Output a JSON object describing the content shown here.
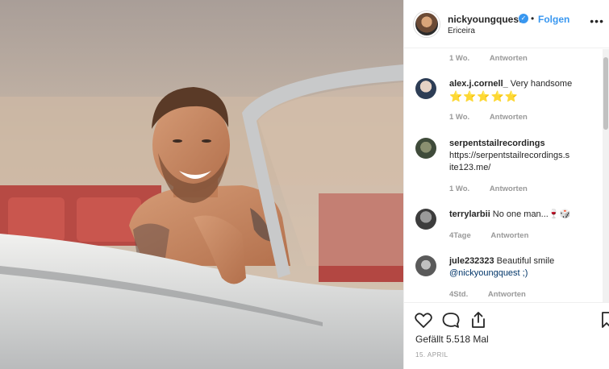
{
  "post": {
    "username": "nickyoungquest",
    "verified_mark": "✓",
    "separator": "•",
    "follow_label": "Folgen",
    "location": "Ericeira",
    "more_icon": "•••"
  },
  "first_meta": {
    "time": "1 Wo.",
    "reply": "Antworten"
  },
  "comments": [
    {
      "user": "alex.j.cornell_",
      "text": "Very handsome",
      "extra": "⭐⭐⭐⭐⭐",
      "time": "1 Wo.",
      "reply": "Antworten"
    },
    {
      "user": "serpentstailrecordings",
      "text": "https://serpentstailrecordings.site123.me/",
      "time": "1 Wo.",
      "reply": "Antworten"
    },
    {
      "user": "terrylarbii",
      "text": "No one man...🍷🎲",
      "time": "4Tage",
      "reply": "Antworten"
    },
    {
      "user": "jule232323",
      "text": "Beautiful smile",
      "mention": "@nickyoungquest ;)",
      "time": "4Std.",
      "reply": "Antworten"
    }
  ],
  "actions": {
    "like_icon": "heart-icon",
    "comment_icon": "comment-icon",
    "share_icon": "share-icon",
    "save_icon": "bookmark-icon",
    "likes": "Gefällt 5.518 Mal",
    "date": "15. APRIL"
  },
  "colors": {
    "accent": "#3897f0",
    "text": "#262626",
    "muted": "#999999",
    "link": "#003569"
  }
}
